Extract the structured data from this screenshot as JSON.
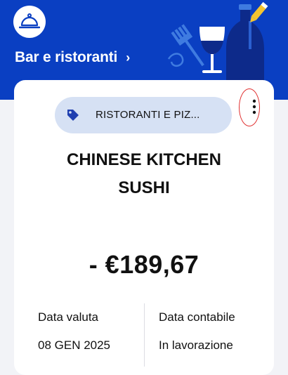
{
  "header": {
    "category_title": "Bar e ristoranti",
    "chevron": "›",
    "icon": "cloche-icon",
    "illustration": "bottle-wineglass-fork-pencil",
    "background_color": "#0a3fc2"
  },
  "transaction": {
    "category_chip": "RISTORANTI E PIZ...",
    "chip_icon": "tag-icon",
    "more_icon": "more-vertical-icon",
    "merchant_line1": "CHINESE KITCHEN",
    "merchant_line2": "SUSHI",
    "amount": "- €189,67",
    "value_date_label": "Data valuta",
    "value_date": "08 GEN 2025",
    "accounting_date_label": "Data contabile",
    "accounting_date": "In lavorazione"
  },
  "annotation": {
    "color": "#e03030"
  }
}
